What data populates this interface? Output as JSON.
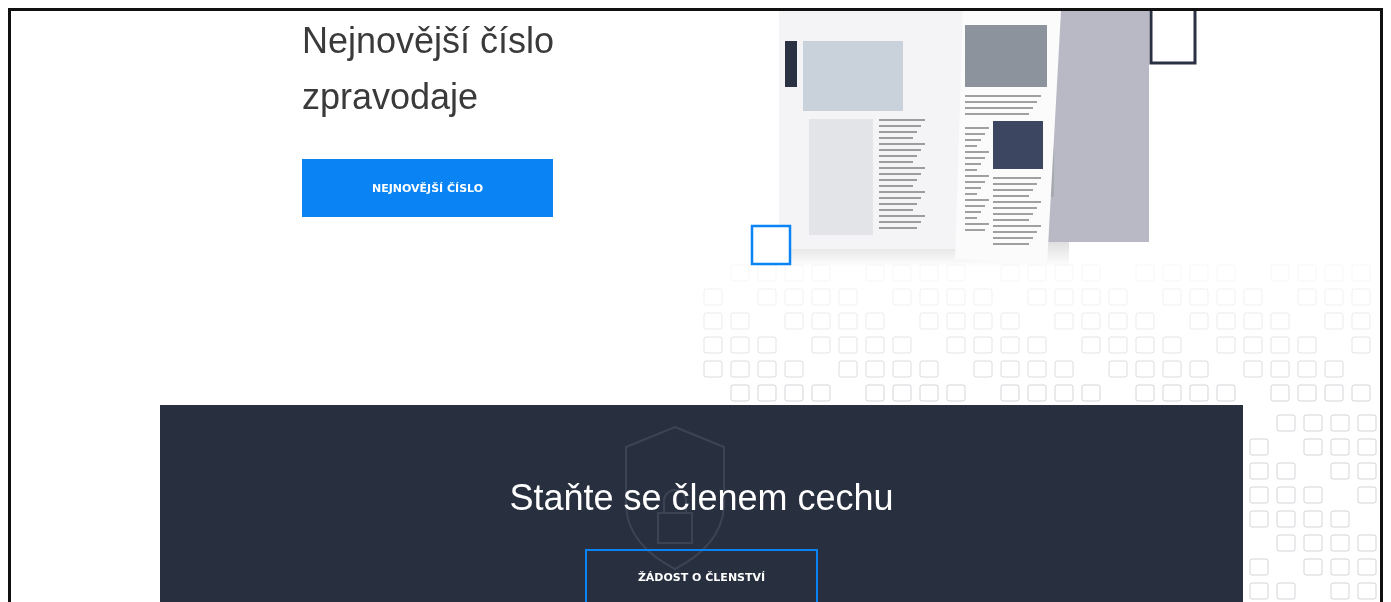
{
  "newsletter": {
    "heading_lines": [
      "Nejnovější číslo",
      "zpravodaje"
    ],
    "button": "NEJNOVĚJŠÍ ČÍSLO"
  },
  "membership": {
    "heading": "Staňte se členem cechu",
    "button": "ŽÁDOST O ČLENSTVÍ"
  }
}
